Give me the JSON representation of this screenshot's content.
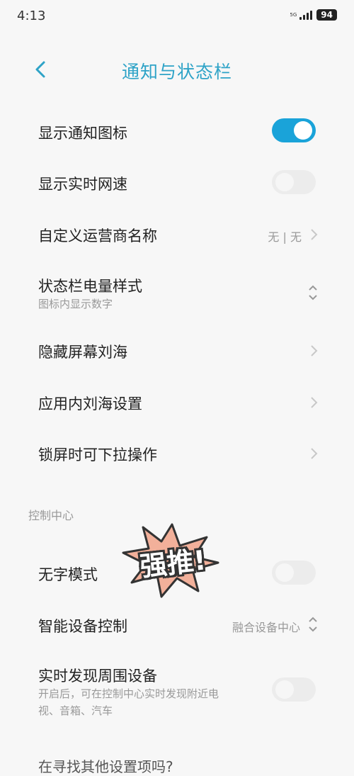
{
  "status_bar": {
    "time": "4:13",
    "network": "5G",
    "battery": "94"
  },
  "header": {
    "title": "通知与状态栏",
    "back_icon": "chevron-left-icon"
  },
  "colors": {
    "accent": "#1aa3d9",
    "title": "#2ea3c7"
  },
  "items": {
    "show_notif_icon": {
      "label": "显示通知图标",
      "toggle": true
    },
    "realtime_speed": {
      "label": "显示实时网速",
      "toggle": false
    },
    "carrier_name": {
      "label": "自定义运营商名称",
      "value": "无 | 无"
    },
    "battery_style": {
      "label": "状态栏电量样式",
      "subtitle": "图标内显示数字"
    },
    "hide_notch": {
      "label": "隐藏屏幕刘海"
    },
    "app_notch": {
      "label": "应用内刘海设置"
    },
    "lock_pulldown": {
      "label": "锁屏时可下拉操作"
    }
  },
  "control_center": {
    "section_title": "控制中心",
    "textless_mode": {
      "label": "无字模式",
      "toggle": false
    },
    "smart_device": {
      "label": "智能设备控制",
      "value": "融合设备中心"
    },
    "discover_nearby": {
      "label": "实时发现周围设备",
      "subtitle_line1": "开启后，可在控制中心实时发现附近电",
      "subtitle_line2": "视、音箱、汽车",
      "toggle": false
    }
  },
  "sticker": {
    "text": "强推!"
  },
  "footer": {
    "partial_text": "在寻找其他设置项吗?"
  }
}
